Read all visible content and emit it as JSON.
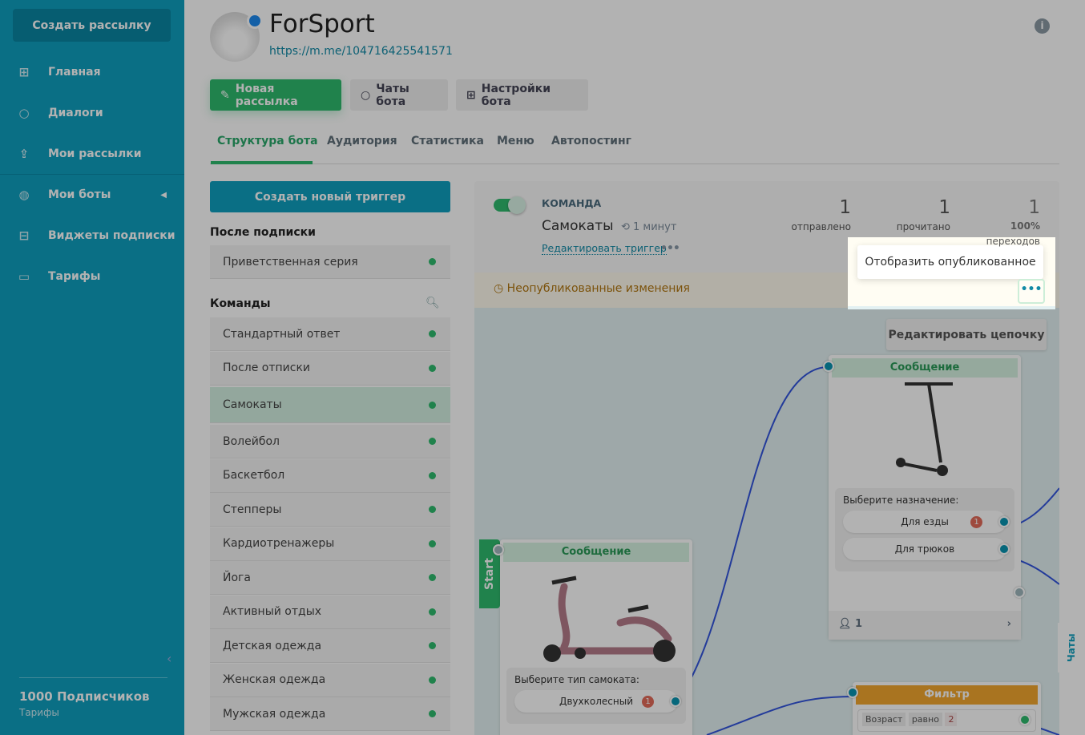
{
  "sidebar": {
    "create": "Создать рассылку",
    "items": [
      {
        "label": "Главная",
        "icon": "sliders-icon"
      },
      {
        "label": "Диалоги",
        "icon": "chat-icon"
      },
      {
        "label": "Мои рассылки",
        "icon": "upload-icon"
      },
      {
        "label": "Мои боты",
        "icon": "globe-icon"
      },
      {
        "label": "Виджеты подписки",
        "icon": "widget-icon"
      },
      {
        "label": "Тарифы",
        "icon": "wallet-icon"
      }
    ],
    "plan": "1000 Подписчиков",
    "plan_link": "Тарифы"
  },
  "bot": {
    "name": "ForSport",
    "url": "https://m.me/104716425541571"
  },
  "actions": {
    "new": "Новая рассылка",
    "chats": "Чаты бота",
    "settings": "Настройки бота"
  },
  "tabs": [
    "Структура бота",
    "Аудитория",
    "Статистика",
    "Меню",
    "Автопостинг"
  ],
  "triggers": {
    "create": "Создать новый триггер",
    "after_sub": "После подписки",
    "welcome": "Приветственная серия",
    "commands": "Команды",
    "list": [
      "Стандартный ответ",
      "После отписки",
      "Самокаты",
      "Волейбол",
      "Баскетбол",
      "Степперы",
      "Кардиотренажеры",
      "Йога",
      "Активный отдых",
      "Детская одежда",
      "Женская одежда",
      "Мужская одежда"
    ],
    "active": "Самокаты"
  },
  "trigger": {
    "kind": "КОМАНДА",
    "name": "Самокаты",
    "age": "1 минут",
    "edit": "Редактировать триггер",
    "stats": [
      {
        "value": "1",
        "label": "отправлено"
      },
      {
        "value": "1",
        "label": "прочитано"
      },
      {
        "value": "1",
        "label": "100%",
        "sub": "переходов"
      }
    ],
    "unpublished": "Неопубликованные изменения",
    "popup": "Отобразить опубликованное",
    "edit_chain": "Редактировать цепочку"
  },
  "flow": {
    "start": "Start",
    "node1": {
      "header": "Сообщение",
      "question": "Выберите тип самоката:",
      "options": [
        {
          "label": "Двухколесный",
          "count": "1"
        }
      ]
    },
    "node2": {
      "header": "Сообщение",
      "question": "Выберите назначение:",
      "options": [
        {
          "label": "Для езды",
          "count": "1"
        },
        {
          "label": "Для трюков"
        }
      ],
      "subscribers": "1"
    },
    "filter": {
      "header": "Фильтр",
      "field": "Возраст",
      "op": "равно",
      "value": "2"
    }
  },
  "chats_tab": "Чаты"
}
